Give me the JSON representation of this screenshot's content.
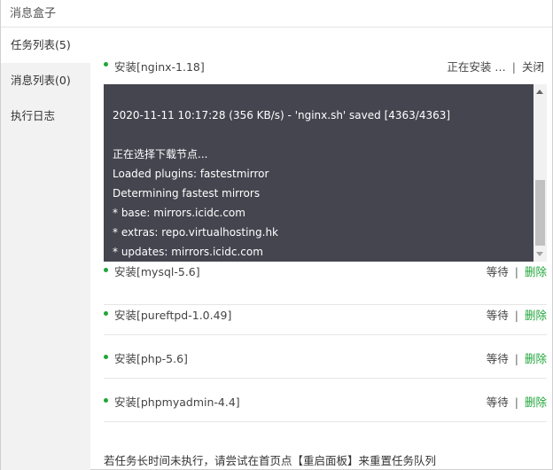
{
  "window": {
    "title": "消息盒子"
  },
  "sidebar": {
    "items": [
      {
        "label": "任务列表(5)"
      },
      {
        "label": "消息列表(0)"
      },
      {
        "label": "执行日志"
      }
    ]
  },
  "tasks": [
    {
      "name": "安装[nginx-1.18]",
      "status": "正在安装 …",
      "action": "关闭"
    },
    {
      "name": "安装[mysql-5.6]",
      "status": "等待",
      "action": "删除"
    },
    {
      "name": "安装[pureftpd-1.0.49]",
      "status": "等待",
      "action": "删除"
    },
    {
      "name": "安装[php-5.6]",
      "status": "等待",
      "action": "删除"
    },
    {
      "name": "安装[phpmyadmin-4.4]",
      "status": "等待",
      "action": "删除"
    }
  ],
  "log": {
    "lines": [
      "2020-11-11 10:17:28 (356 KB/s) - 'nginx.sh' saved [4363/4363]",
      "",
      "正在选择下载节点...",
      "Loaded plugins: fastestmirror",
      "Determining fastest mirrors",
      "* base: mirrors.icidc.com",
      "* extras: repo.virtualhosting.hk",
      "* updates: mirrors.icidc.com"
    ]
  },
  "separator": "|",
  "footer": {
    "note": "若任务长时间未执行，请尝试在首页点【重启面板】来重置任务队列"
  },
  "colors": {
    "accent_green": "#20a53a",
    "log_background": "#44454f",
    "sidebar_background": "#f2f2f2"
  }
}
